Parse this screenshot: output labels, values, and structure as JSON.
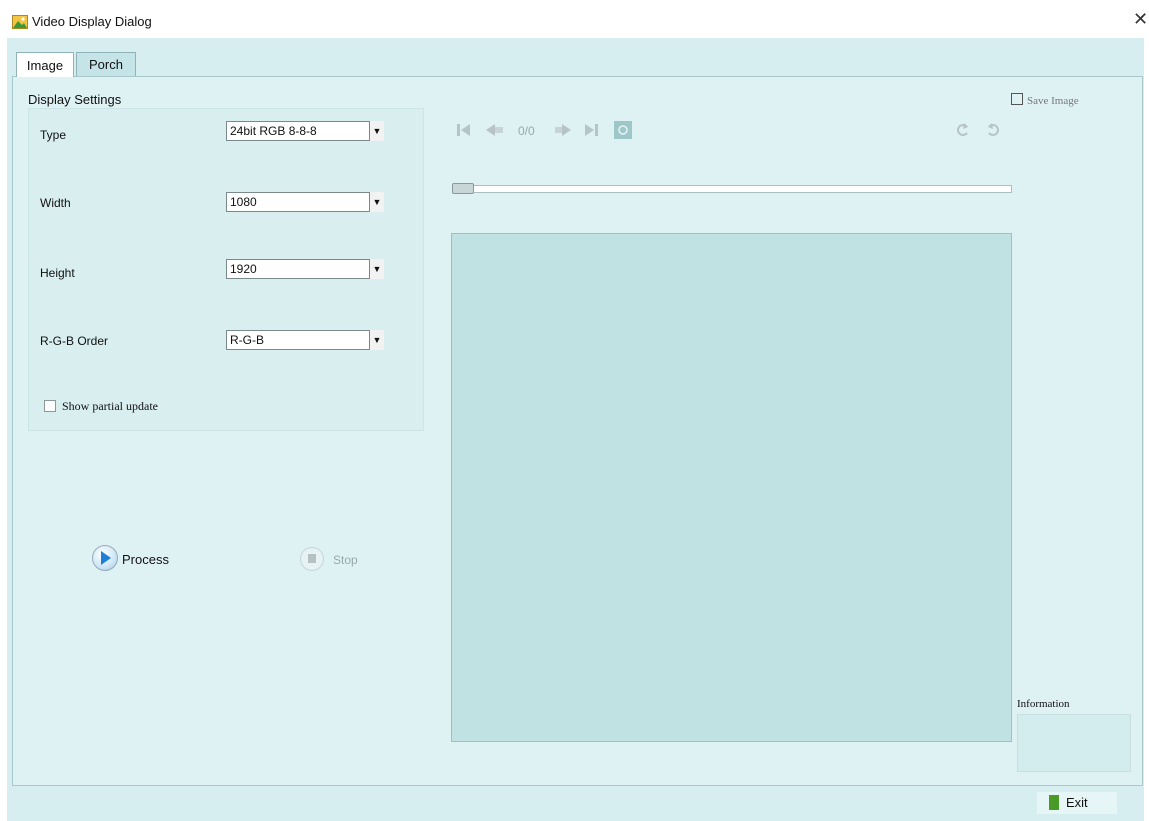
{
  "window": {
    "title": "Video Display Dialog",
    "close_glyph": "✕"
  },
  "tabs": [
    {
      "label": "Image",
      "active": true
    },
    {
      "label": "Porch",
      "active": false
    }
  ],
  "display_settings": {
    "section_label": "Display Settings",
    "fields": [
      {
        "label": "Type",
        "value": "24bit RGB 8-8-8"
      },
      {
        "label": "Width",
        "value": "1080"
      },
      {
        "label": "Height",
        "value": "1920"
      },
      {
        "label": "R-G-B Order",
        "value": "R-G-B"
      }
    ],
    "show_partial_update": {
      "label": "Show partial update",
      "checked": false
    }
  },
  "actions": {
    "process_label": "Process",
    "stop_label": "Stop"
  },
  "player": {
    "counter": "0/0"
  },
  "save": {
    "label": "Save Image"
  },
  "information": {
    "label": "Information"
  },
  "exit": {
    "label": "Exit"
  },
  "colors": {
    "frame_bg": "#d7eef0",
    "image_area_bg": "#c1e2e3",
    "play_accent": "#1e7fd6",
    "exit_icon": "#4a9a28"
  },
  "icons": [
    "image-app-icon",
    "close-icon",
    "chevron-down-icon",
    "play-icon",
    "stop-icon",
    "first-frame-icon",
    "prev-frame-icon",
    "next-frame-icon",
    "last-frame-icon",
    "snapshot-icon",
    "rotate-left-icon",
    "rotate-right-icon",
    "save-icon",
    "exit-icon"
  ]
}
